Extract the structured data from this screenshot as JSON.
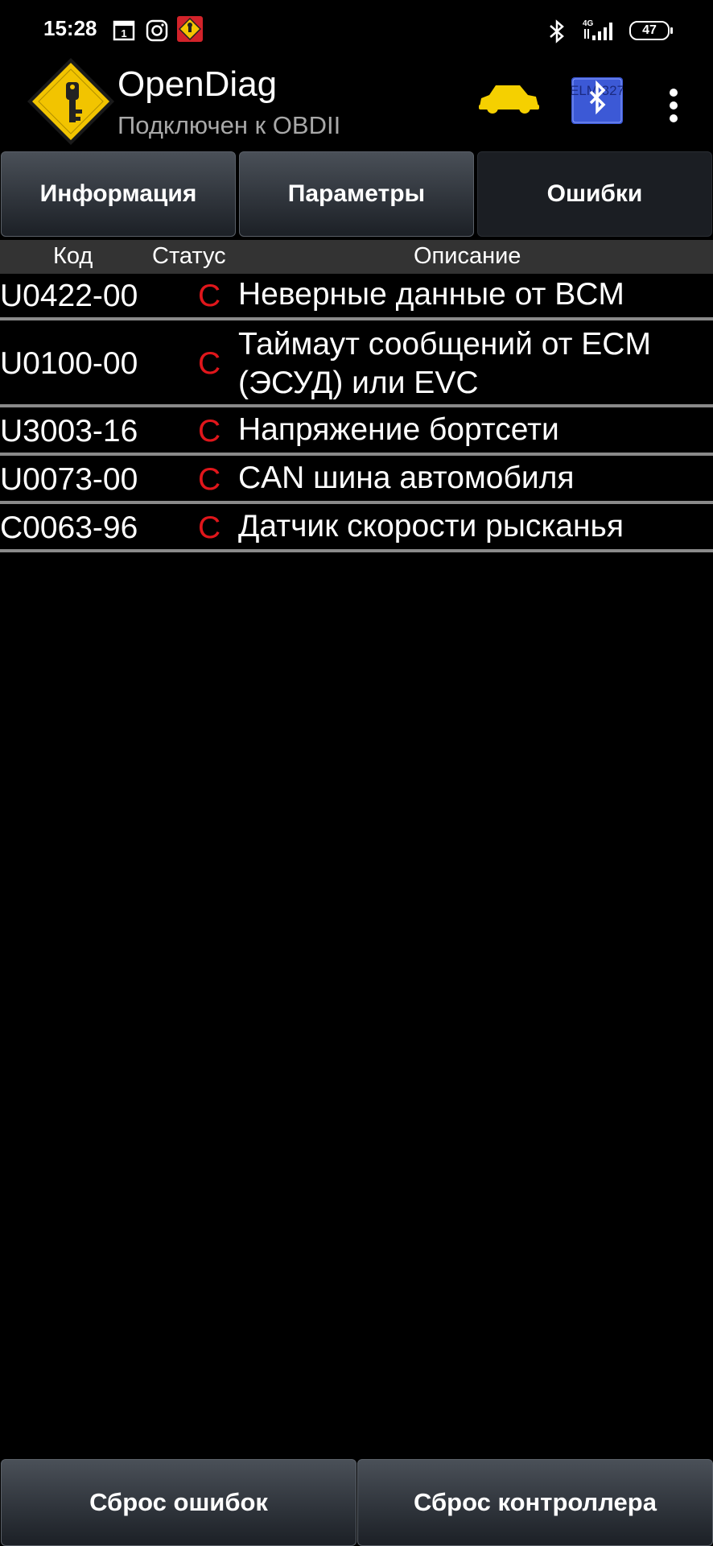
{
  "status_bar": {
    "time": "15:28",
    "calendar_day": "1",
    "network": "4G",
    "battery": "47",
    "icons": [
      "calendar-icon",
      "instagram-icon",
      "opendiag-notification-icon",
      "bluetooth-icon",
      "signal-icon",
      "battery-icon"
    ]
  },
  "app_bar": {
    "title": "OpenDiag",
    "subtitle": "Подключен к OBDII",
    "elm_label": "ELM 327",
    "colors": {
      "logo_yellow": "#f2c400",
      "car_yellow": "#f5d000",
      "elm_blue": "#3c59d6"
    }
  },
  "tabs": [
    {
      "label": "Информация",
      "active": false
    },
    {
      "label": "Параметры",
      "active": false
    },
    {
      "label": "Ошибки",
      "active": true
    }
  ],
  "table": {
    "headers": {
      "code": "Код",
      "status": "Статус",
      "description": "Описание"
    },
    "rows": [
      {
        "code": "U0422-00",
        "status": "C",
        "description": "Неверные данные от BCM"
      },
      {
        "code": "U0100-00",
        "status": "C",
        "description": "Таймаут сообщений от ECM (ЭСУД) или EVC"
      },
      {
        "code": "U3003-16",
        "status": "C",
        "description": "Напряжение бортсети"
      },
      {
        "code": "U0073-00",
        "status": "C",
        "description": "CAN шина автомобиля"
      },
      {
        "code": "C0063-96",
        "status": "C",
        "description": "Датчик скорости рысканья"
      }
    ],
    "status_color": "#e0161b"
  },
  "buttons": {
    "reset_errors": "Сброс ошибок",
    "reset_controller": "Сброс контроллера"
  }
}
